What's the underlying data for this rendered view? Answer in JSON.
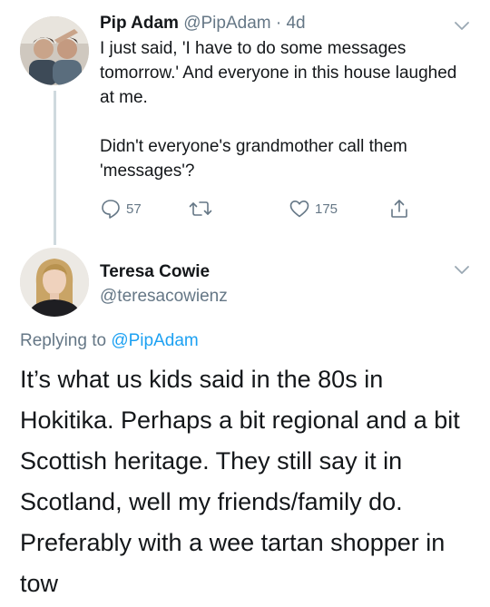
{
  "original_tweet": {
    "author_name": "Pip Adam",
    "author_handle": "@PipAdam",
    "separator": "·",
    "time_ago": "4d",
    "paragraph_1": "I just said, 'I have to do some messages tomorrow.' And everyone in this house laughed at me.",
    "paragraph_2": "Didn't everyone's grandmother call them 'messages'?",
    "reply_count": "57",
    "like_count": "175",
    "icons": {
      "reply": "reply-icon",
      "retweet": "retweet-icon",
      "like": "heart-icon",
      "share": "share-icon",
      "menu": "chevron-down-icon"
    }
  },
  "reply_tweet": {
    "author_name": "Teresa Cowie",
    "author_handle": "@teresacowienz",
    "replying_prefix": "Replying to",
    "replying_mention": "@PipAdam",
    "text": "It’s what us kids said in the 80s in Hokitika. Perhaps a bit regional and a bit Scottish heritage. They still say it in Scotland, well my friends/family do. Preferably with a wee tartan shopper in tow"
  },
  "colors": {
    "text": "#14171a",
    "secondary": "#657786",
    "link": "#1da1f2",
    "thread_line": "#cfd9de"
  }
}
